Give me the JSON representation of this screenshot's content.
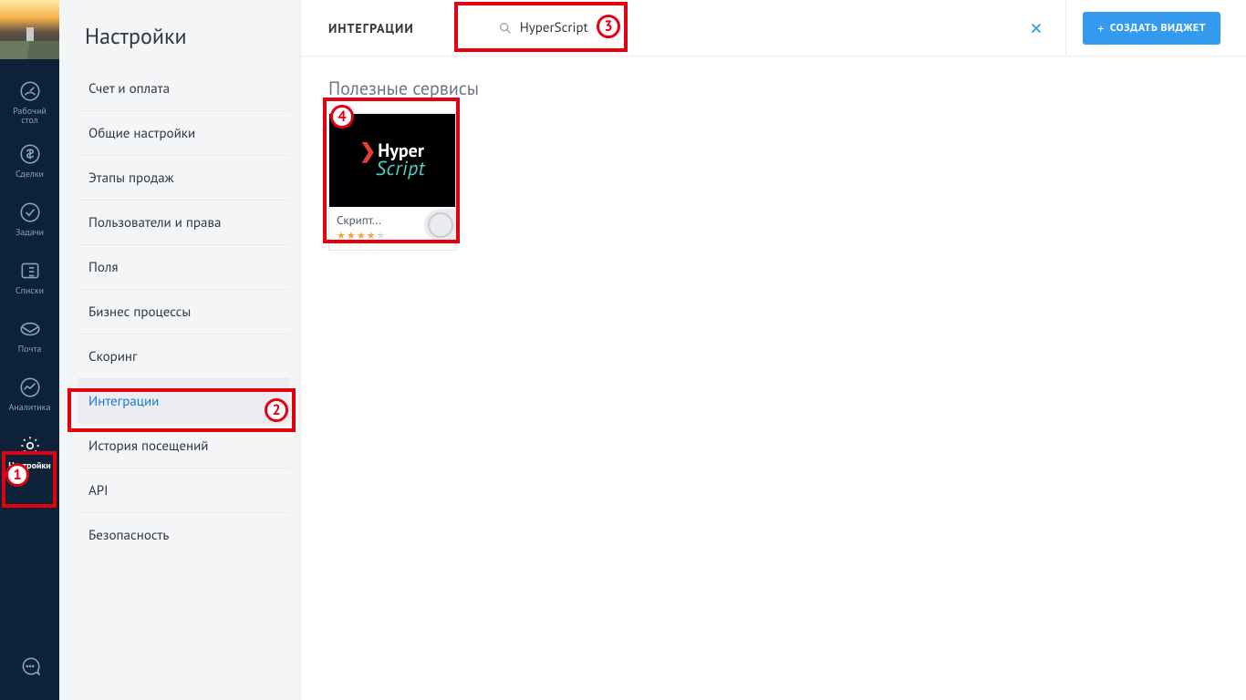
{
  "rail": {
    "items": [
      {
        "label": "Рабочий\nстол"
      },
      {
        "label": "Сделки"
      },
      {
        "label": "Задачи"
      },
      {
        "label": "Списки"
      },
      {
        "label": "Почта"
      },
      {
        "label": "Аналитика"
      },
      {
        "label": "Настройки"
      }
    ]
  },
  "settings": {
    "title": "Настройки",
    "links": [
      "Счет и оплата",
      "Общие настройки",
      "Этапы продаж",
      "Пользователи и права",
      "Поля",
      "Бизнес процессы",
      "Скоринг",
      "Интеграции",
      "История посещений",
      "API",
      "Безопасность"
    ],
    "active_index": 7
  },
  "topbar": {
    "title": "ИНТЕГРАЦИИ",
    "search_value": "HyperScript",
    "create_label": "СОЗДАТЬ ВИДЖЕТ"
  },
  "content": {
    "section_title": "Полезные сервисы",
    "widget": {
      "name": "Скрипт...",
      "brand_top": "Hyper",
      "brand_bottom": "Script",
      "rating": 4
    }
  },
  "annotations": {
    "1": "1",
    "2": "2",
    "3": "3",
    "4": "4"
  }
}
